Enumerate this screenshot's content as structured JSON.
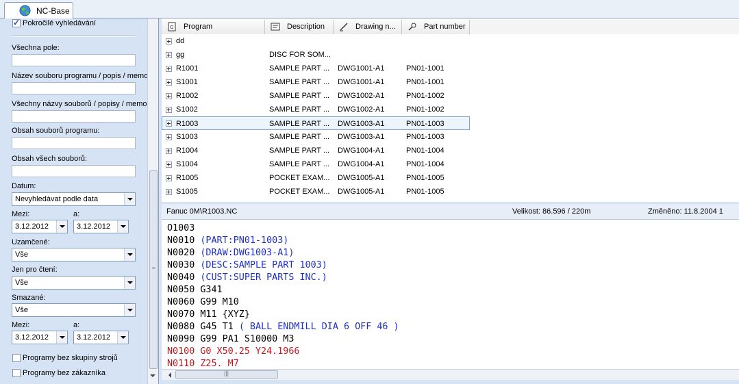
{
  "tab": {
    "label": "NC-Base"
  },
  "left": {
    "advanced_search": "Pokročilé vyhledávání",
    "all_fields": "Všechna pole:",
    "name_desc_memo": "Název souboru programu / popis / memo:",
    "all_names": "Všechny názvy souborů / popisy / memo:",
    "program_content": "Obsah souborů programu:",
    "all_content": "Obsah všech souborů:",
    "date_label": "Datum:",
    "date_select": "Nevyhledávat podle data",
    "between1": "Mezi:",
    "and1": "a:",
    "from_date1": "3.12.2012",
    "to_date1": "3.12.2012",
    "locked_label": "Uzamčené:",
    "locked_value": "Vše",
    "readonly_label": "Jen pro čtení:",
    "readonly_value": "Vše",
    "deleted_label": "Smazané:",
    "deleted_value": "Vše",
    "between2": "Mezi:",
    "and2": "a:",
    "from_date2": "3.12.2012",
    "to_date2": "3.12.2012",
    "no_machine_group": "Programy bez skupiny strojů",
    "no_customer": "Programy bez zákazníka"
  },
  "grid": {
    "columns": {
      "program": "Program",
      "description": "Description",
      "drawing": "Drawing n...",
      "part": "Part number"
    },
    "rows": [
      {
        "program": "dd",
        "description": "",
        "drawing": "",
        "part": ""
      },
      {
        "program": "gg",
        "description": "DISC FOR SOM...",
        "drawing": "",
        "part": ""
      },
      {
        "program": "R1001",
        "description": "SAMPLE PART ...",
        "drawing": "DWG1001-A1",
        "part": "PN01-1001"
      },
      {
        "program": "S1001",
        "description": "SAMPLE PART ...",
        "drawing": "DWG1001-A1",
        "part": "PN01-1001"
      },
      {
        "program": "R1002",
        "description": "SAMPLE PART ...",
        "drawing": "DWG1002-A1",
        "part": "PN01-1002"
      },
      {
        "program": "S1002",
        "description": "SAMPLE PART ...",
        "drawing": "DWG1002-A1",
        "part": "PN01-1002"
      },
      {
        "program": "R1003",
        "description": "SAMPLE PART ...",
        "drawing": "DWG1003-A1",
        "part": "PN01-1003"
      },
      {
        "program": "S1003",
        "description": "SAMPLE PART ...",
        "drawing": "DWG1003-A1",
        "part": "PN01-1003"
      },
      {
        "program": "R1004",
        "description": "SAMPLE PART ...",
        "drawing": "DWG1004-A1",
        "part": "PN01-1004"
      },
      {
        "program": "S1004",
        "description": "SAMPLE PART ...",
        "drawing": "DWG1004-A1",
        "part": "PN01-1004"
      },
      {
        "program": "R1005",
        "description": "POCKET EXAM...",
        "drawing": "DWG1005-A1",
        "part": "PN01-1005"
      },
      {
        "program": "S1005",
        "description": "POCKET EXAM...",
        "drawing": "DWG1005-A1",
        "part": "PN01-1005"
      }
    ]
  },
  "editor": {
    "filename": "Fanuc 0M\\R1003.NC",
    "size": "Velikost: 86.596 / 220m",
    "modified": "Změněno: 11.8.2004 1",
    "lines": [
      {
        "num": "O1003",
        "rest": ""
      },
      {
        "num": "N0010 ",
        "rest": "(PART:PN01-1003)"
      },
      {
        "num": "N0020 ",
        "rest": "(DRAW:DWG1003-A1)"
      },
      {
        "num": "N0030 ",
        "rest": "(DESC:SAMPLE PART 1003)"
      },
      {
        "num": "N0040 ",
        "rest": "(CUST:SUPER PARTS INC.)"
      },
      {
        "num": "N0050 G341",
        "rest": ""
      },
      {
        "num": "N0060 G99 M10",
        "rest": ""
      },
      {
        "num": "N0070 M11 {XYZ}",
        "rest": ""
      },
      {
        "num": "N0080 G45 T1 ",
        "rest": "( BALL ENDMILL DIA 6 OFF 46 )"
      },
      {
        "num": "N0090 G99 PA1 S10000 M3",
        "rest": ""
      },
      {
        "num": "N0100 G0 X50.25 Y24.1966",
        "rest": ""
      },
      {
        "num": "N0110 Z25. M7",
        "rest": ""
      }
    ]
  },
  "colors": {
    "panel": "#d6e3f5",
    "comment": "#1d2fc8",
    "rapid": "#c4161c",
    "selection": "#7da2ce"
  }
}
